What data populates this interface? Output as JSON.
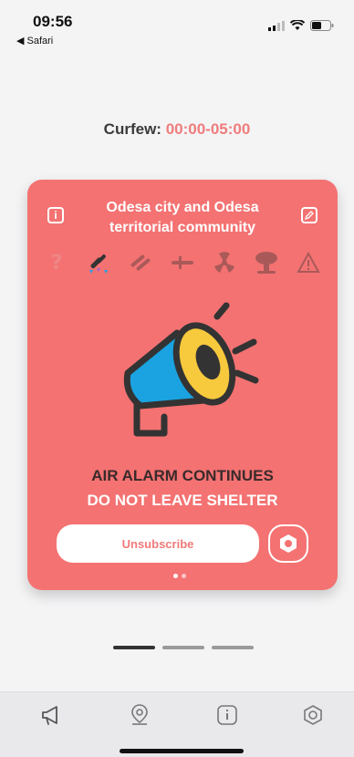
{
  "status": {
    "time": "09:56",
    "back_app": "◀ Safari"
  },
  "curfew": {
    "label": "Curfew:",
    "hours": "00:00-05:00"
  },
  "card": {
    "title": "Odesa city and Odesa territorial community",
    "threats": [
      "unknown-threat-icon",
      "artillery-icon",
      "missiles-icon",
      "drone-icon",
      "radiation-icon",
      "explosion-icon",
      "warning-icon"
    ],
    "alarm_title": "AIR ALARM CONTINUES",
    "alarm_sub": "DO NOT LEAVE SHELTER",
    "unsubscribe_label": "Unsubscribe",
    "colors": {
      "card": "#f47272",
      "megaphone_blue": "#1aa3e0",
      "megaphone_yellow": "#f7c93c",
      "accent": "#f07c7c"
    }
  },
  "tabs": [
    "megaphone-icon",
    "map-pin-icon",
    "info-icon",
    "settings-icon"
  ]
}
